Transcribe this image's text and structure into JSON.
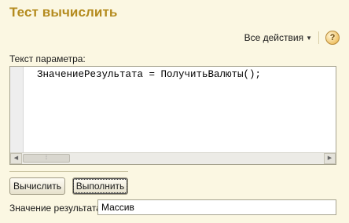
{
  "window": {
    "title": "Тест вычислить"
  },
  "toolbar": {
    "all_actions_label": "Все действия",
    "help_label": "?"
  },
  "form": {
    "param_label": "Текст параметра:",
    "code_text": "ЗначениеРезультата = ПолучитьВалюты();",
    "result_label": "Значение результата:",
    "result_value": "Массив"
  },
  "buttons": {
    "calculate_label": "Вычислить",
    "execute_label": "Выполнить"
  },
  "icons": {
    "dropdown": "chevron-down-icon",
    "help": "help-icon",
    "scroll_left": "scroll-left-arrow-icon",
    "scroll_right": "scroll-right-arrow-icon"
  },
  "colors": {
    "title": "#b48b1e",
    "background": "#fbf7e2"
  }
}
